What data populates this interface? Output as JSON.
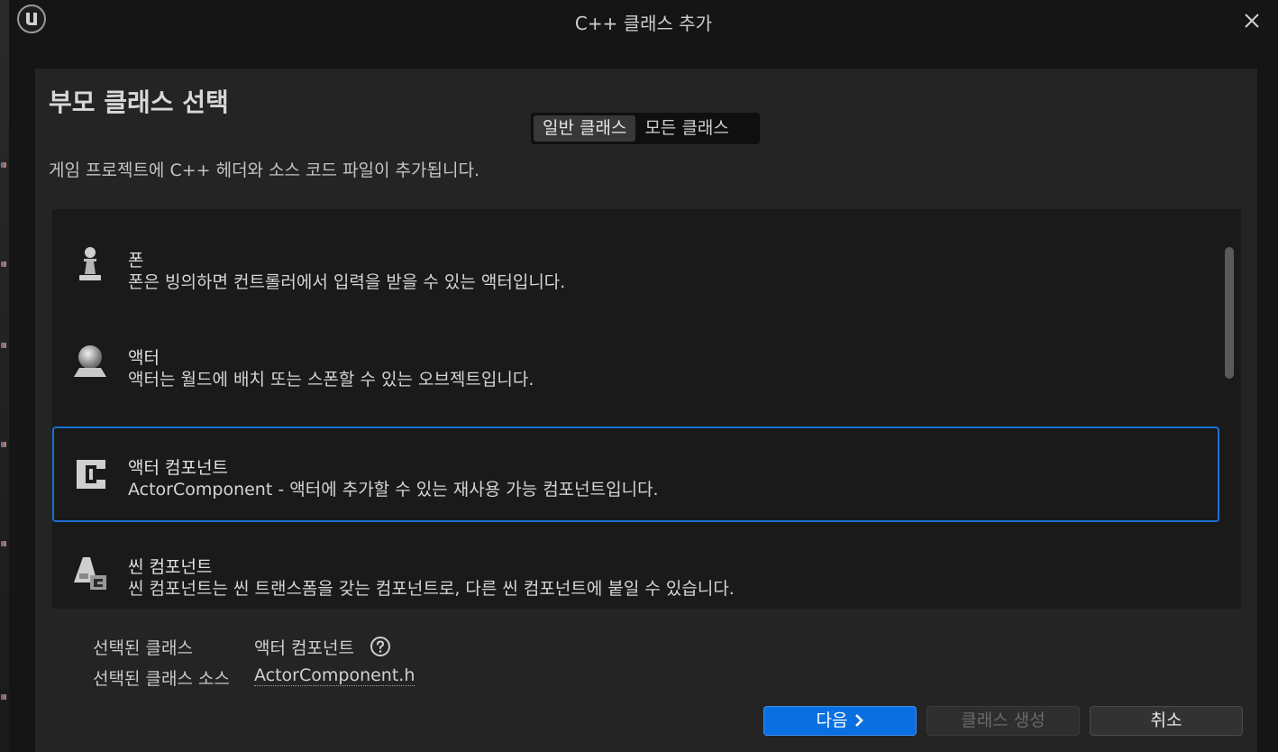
{
  "window": {
    "title": "C++ 클래스 추가"
  },
  "panel": {
    "title": "부모 클래스 선택",
    "tabs": [
      {
        "label": "일반 클래스",
        "active": true
      },
      {
        "label": "모든 클래스",
        "active": false
      }
    ],
    "description": "게임 프로젝트에 C++ 헤더와 소스 코드 파일이 추가됩니다."
  },
  "classes": [
    {
      "icon": "pawn-icon",
      "name": "폰",
      "description": "폰은 빙의하면 컨트롤러에서 입력을 받을 수 있는 액터입니다.",
      "selected": false
    },
    {
      "icon": "actor-sphere-icon",
      "name": "액터",
      "description": "액터는 월드에 배치 또는 스폰할 수 있는 오브젝트입니다.",
      "selected": false
    },
    {
      "icon": "actor-component-icon",
      "name": "액터 컴포넌트",
      "description": "ActorComponent - 액터에 추가할 수 있는 재사용 가능 컴포넌트입니다.",
      "selected": true
    },
    {
      "icon": "scene-component-icon",
      "name": "씬 컴포넌트",
      "description": "씬 컴포넌트는 씬 트랜스폼을 갖는 컴포넌트로, 다른 씬 컴포넌트에 붙일 수 있습니다.",
      "selected": false
    }
  ],
  "selection": {
    "class_label": "선택된 클래스",
    "class_value": "액터 컴포넌트",
    "source_label": "선택된 클래스 소스",
    "source_value": "ActorComponent.h"
  },
  "buttons": {
    "next": "다음",
    "create": "클래스 생성",
    "cancel": "취소"
  },
  "colors": {
    "accent": "#0a6fe0",
    "selection_border": "#1a6fd1"
  }
}
